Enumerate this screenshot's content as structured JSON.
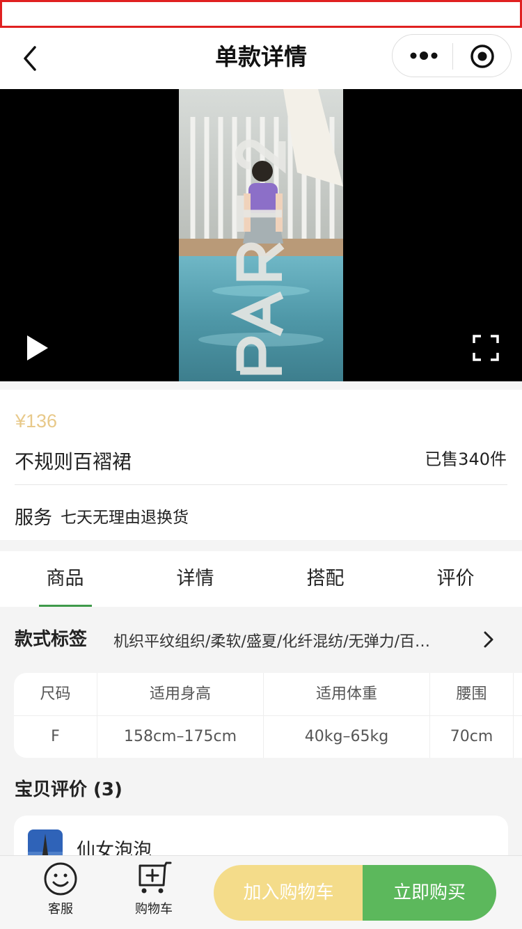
{
  "header": {
    "title": "单款详情"
  },
  "video": {
    "overlay_text": "PART 2"
  },
  "product": {
    "price": "¥136",
    "name": "不规则百褶裙",
    "sold": "已售340件",
    "service_label": "服务",
    "service_value": "七天无理由退换货"
  },
  "tabs": [
    {
      "label": "商品"
    },
    {
      "label": "详情"
    },
    {
      "label": "搭配"
    },
    {
      "label": "评价"
    }
  ],
  "style_tags": {
    "label": "款式标签",
    "value": "机织平纹组织/柔软/盛夏/化纤混纺/无弹力/百…"
  },
  "size_table": {
    "headers": [
      "尺码",
      "适用身高",
      "适用体重",
      "腰围"
    ],
    "rows": [
      [
        "F",
        "158cm–175cm",
        "40kg–65kg",
        "70cm"
      ]
    ]
  },
  "reviews": {
    "title": "宝贝评价 (3)",
    "items": [
      {
        "name": "仙女泡泡"
      }
    ]
  },
  "bottom_bar": {
    "service_label": "客服",
    "cart_label": "购物车",
    "add_to_cart": "加入购物车",
    "buy_now": "立即购买"
  },
  "colors": {
    "accent_green": "#5cb85c",
    "add_cart_yellow": "#f4dc8a",
    "price_color": "#e8c98a",
    "status_border": "#e02020"
  }
}
